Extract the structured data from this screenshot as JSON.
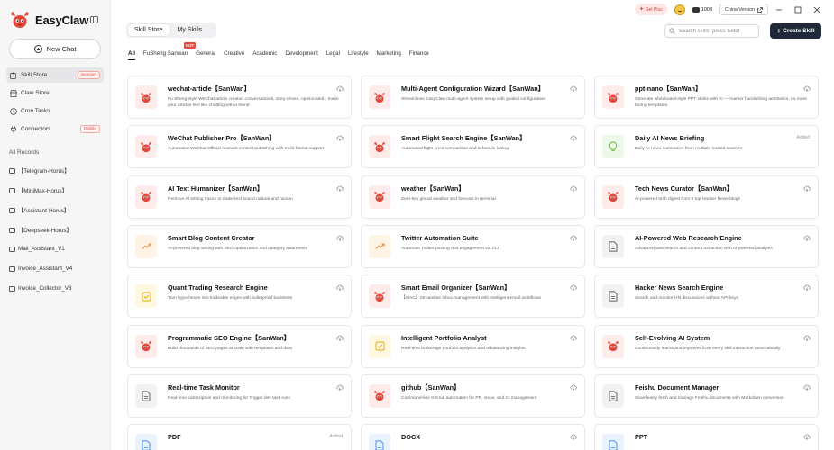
{
  "app": {
    "brand": "EasyClaw",
    "new_chat": "New Chat"
  },
  "sidebar": {
    "nav": [
      {
        "label": "Skill Store",
        "badge": "Session",
        "icon": "puzzle-icon"
      },
      {
        "label": "Claw Store",
        "badge": "",
        "icon": "store-icon"
      },
      {
        "label": "Cron Tasks",
        "badge": "",
        "icon": "clock-icon"
      },
      {
        "label": "Connectors",
        "badge": "Mobile",
        "icon": "plug-icon"
      }
    ],
    "records_title": "All Records",
    "records": [
      "【Telegram-Horus】",
      "【MiniMax-Horus】",
      "【Assistant-Horus】",
      "【Deepseek-Horus】",
      "Mail_Assistant_V1",
      "Invoice_Assistant_V4",
      "Invoice_Collector_V3"
    ]
  },
  "topbar": {
    "get_plus": "Get Plus",
    "credits": "1003",
    "region": "China Version"
  },
  "tabs": [
    "Skill Store",
    "My Skills"
  ],
  "search": {
    "placeholder": "Search skills, press Enter"
  },
  "create_button": "Create Skill",
  "hot_badge": "HOT",
  "categories": [
    "All",
    "FuSheng Sanwan",
    "General",
    "Creative",
    "Academic",
    "Development",
    "Legal",
    "Lifestyle",
    "Marketing",
    "Finance"
  ],
  "colors": {
    "accent": "#e04b3c",
    "dark": "#1f2937"
  },
  "skills": [
    {
      "title": "wechat-article【SanWan】",
      "desc": "Fu Sheng-style WeChat article creator: conversational, story-driven, opinionated - make your articles feel like chatting with a friend",
      "icon": "crawfish-icon",
      "added": false
    },
    {
      "title": "Multi-Agent Configuration Wizard【SanWan】",
      "desc": "Streamlines EasyClaw multi-agent system setup with guided configuration",
      "icon": "crawfish-icon",
      "added": false
    },
    {
      "title": "ppt-nano【SanWan】",
      "desc": "Generate whiteboard-style PPT slides with AI — marker handwriting aesthetics, no more boring templates.",
      "icon": "crawfish-icon",
      "added": false
    },
    {
      "title": "WeChat Publisher Pro【SanWan】",
      "desc": "Automated WeChat Official Account content publishing with multi-format support",
      "icon": "crawfish-icon",
      "added": false
    },
    {
      "title": "Smart Flight Search Engine【SanWan】",
      "desc": "Automated flight price comparison and schedule lookup",
      "icon": "crawfish-icon",
      "added": false
    },
    {
      "title": "Daily AI News Briefing",
      "desc": "Daily AI news summaries from multiple trusted sources",
      "icon": "lightbulb-icon",
      "added": true
    },
    {
      "title": "AI Text Humanizer【SanWan】",
      "desc": "Remove AI writing traces to make text sound natural and human",
      "icon": "crawfish-icon",
      "added": false
    },
    {
      "title": "weather【SanWan】",
      "desc": "Zero-key global weather and forecast in terminal",
      "icon": "crawfish-icon",
      "added": false
    },
    {
      "title": "Tech News Curator【SanWan】",
      "desc": "AI-powered tech digest from 9 top Hacker News blogs",
      "icon": "crawfish-icon",
      "added": false
    },
    {
      "title": "Smart Blog Content Creator",
      "desc": "AI-powered blog writing with SEO optimization and category awareness",
      "icon": "trend-icon",
      "added": false
    },
    {
      "title": "Twitter Automation Suite",
      "desc": "Automate Twitter posting and engagement via CLI",
      "icon": "trend-icon",
      "added": false
    },
    {
      "title": "AI-Powered Web Research Engine",
      "desc": "Advanced web search and content extraction with AI-powered analysis",
      "icon": "document-icon",
      "added": false
    },
    {
      "title": "Quant Trading Research Engine",
      "desc": "Turn hypotheses into tradeable edges with bulletproof backtests",
      "icon": "checkbox-icon",
      "added": false
    },
    {
      "title": "Smart Email Organizer【SanWan】",
      "desc": "【MAC】Streamline inbox management with intelligent email workflows",
      "icon": "crawfish-icon",
      "added": false
    },
    {
      "title": "Hacker News Search Engine",
      "desc": "Search and monitor HN discussions without API keys",
      "icon": "document-icon",
      "added": false
    },
    {
      "title": "Programmatic SEO Engine【SanWan】",
      "desc": "Build thousands of SEO pages at scale with templates and data",
      "icon": "crawfish-icon",
      "added": false
    },
    {
      "title": "Intelligent Portfolio Analyst",
      "desc": "Real-time brokerage portfolio analytics and rebalancing insights",
      "icon": "checkbox-icon",
      "added": false
    },
    {
      "title": "Self-Evolving AI System",
      "desc": "Continuously learns and improves from every skill interaction automatically",
      "icon": "crawfish-icon",
      "added": false
    },
    {
      "title": "Real-time Task Monitor",
      "desc": "Real-time subscription and monitoring for Trigger.dev task runs",
      "icon": "document-icon",
      "added": false
    },
    {
      "title": "github【SanWan】",
      "desc": "Command-line GitHub automation for PR, issue, and CI management",
      "icon": "crawfish-icon",
      "added": false
    },
    {
      "title": "Feishu Document Manager",
      "desc": "Seamlessly fetch and manage Feishu documents with Markdown conversion",
      "icon": "document-icon",
      "added": false
    },
    {
      "title": "PDF",
      "desc": "",
      "icon": "document-blue-icon",
      "added": true
    },
    {
      "title": "DOCX",
      "desc": "",
      "icon": "document-blue-icon",
      "added": false
    },
    {
      "title": "PPT",
      "desc": "",
      "icon": "document-blue-icon",
      "added": false
    }
  ],
  "added_label": "Added"
}
